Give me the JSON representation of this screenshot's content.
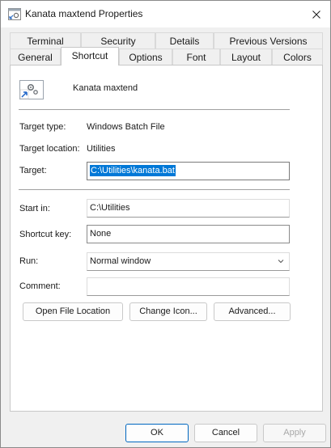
{
  "window": {
    "title": "Kanata maxtend Properties"
  },
  "tabs_back": [
    {
      "label": "Terminal"
    },
    {
      "label": "Security"
    },
    {
      "label": "Details"
    },
    {
      "label": "Previous Versions"
    }
  ],
  "tabs_front": [
    {
      "label": "General"
    },
    {
      "label": "Shortcut"
    },
    {
      "label": "Options"
    },
    {
      "label": "Font"
    },
    {
      "label": "Layout"
    },
    {
      "label": "Colors"
    }
  ],
  "active_tab": "Shortcut",
  "shortcut": {
    "name": "Kanata maxtend",
    "icon": "batch-file-shortcut-icon",
    "target_type_label": "Target type:",
    "target_type_value": "Windows Batch File",
    "target_location_label": "Target location:",
    "target_location_value": "Utilities",
    "target_label": "Target:",
    "target_value": "C:\\Utilities\\kanata.bat",
    "start_in_label": "Start in:",
    "start_in_value": "C:\\Utilities",
    "shortcut_key_label": "Shortcut key:",
    "shortcut_key_value": "None",
    "run_label": "Run:",
    "run_value": "Normal window",
    "comment_label": "Comment:",
    "comment_value": ""
  },
  "panel_buttons": {
    "open_location": "Open File Location",
    "change_icon": "Change Icon...",
    "advanced": "Advanced..."
  },
  "footer": {
    "ok": "OK",
    "cancel": "Cancel",
    "apply": "Apply"
  },
  "colors": {
    "selection": "#0078d7",
    "primary_border": "#0067c0"
  }
}
